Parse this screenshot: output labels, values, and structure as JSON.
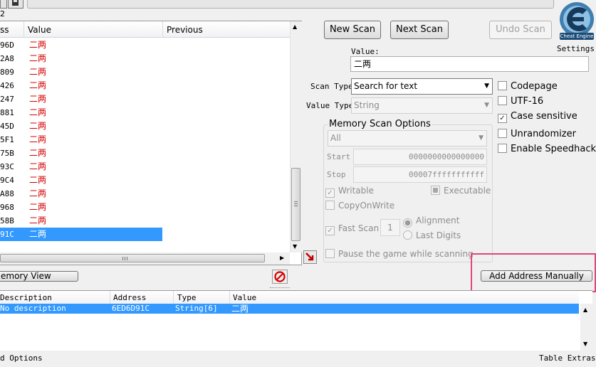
{
  "window": {
    "settings_label": "Settings",
    "logo_text": "Cheat Engine"
  },
  "found_list": {
    "left_cut_label": "2",
    "headers": {
      "address": "ss",
      "value": "Value",
      "previous": "Previous"
    },
    "rows": [
      {
        "addr": "96D",
        "value": "二两"
      },
      {
        "addr": "2A8",
        "value": "二两"
      },
      {
        "addr": "809",
        "value": "二两"
      },
      {
        "addr": "426",
        "value": "二两"
      },
      {
        "addr": "247",
        "value": "二两"
      },
      {
        "addr": "881",
        "value": "二两"
      },
      {
        "addr": "45D",
        "value": "二两"
      },
      {
        "addr": "5F1",
        "value": "二两"
      },
      {
        "addr": "75B",
        "value": "二两"
      },
      {
        "addr": "93C",
        "value": "二两"
      },
      {
        "addr": "9C4",
        "value": "二两"
      },
      {
        "addr": "A88",
        "value": "二两"
      },
      {
        "addr": "968",
        "value": "二两"
      },
      {
        "addr": "58B",
        "value": "二两"
      },
      {
        "addr": "91C",
        "value": "二两",
        "selected": true
      }
    ]
  },
  "scan": {
    "new_scan": "New Scan",
    "next_scan": "Next Scan",
    "undo_scan": "Undo Scan",
    "value_label": "Value:",
    "value": "二两",
    "scan_type_label": "Scan Type",
    "scan_type": "Search for text",
    "value_type_label": "Value Type",
    "value_type": "String"
  },
  "right_options": {
    "codepage": "Codepage",
    "utf16": "UTF-16",
    "case_sensitive": "Case sensitive",
    "unrandomizer": "Unrandomizer",
    "speedhack": "Enable Speedhack"
  },
  "memory_options": {
    "title": "Memory Scan Options",
    "region": "All",
    "start_label": "Start",
    "start": "0000000000000000",
    "stop_label": "Stop",
    "stop": "00007fffffffffff",
    "writable": "Writable",
    "executable": "Executable",
    "copy_on_write": "CopyOnWrite",
    "fast_scan": "Fast Scan",
    "fast_scan_value": "1",
    "alignment": "Alignment",
    "last_digits": "Last Digits",
    "pause_game": "Pause the game while scanning"
  },
  "middle_bar": {
    "memory_view": "emory View",
    "add_address_manually": "Add Address Manually"
  },
  "address_table": {
    "headers": {
      "description": "Description",
      "address": "Address",
      "type": "Type",
      "value": "Value"
    },
    "rows": [
      {
        "description": "No description",
        "address": "6ED6D91C",
        "type": "String[6]",
        "value": "二两"
      }
    ]
  },
  "footer": {
    "advanced_options": "d Options",
    "table_extras": "Table Extras"
  },
  "colors": {
    "selection": "#3399ff",
    "value_red": "#d40000",
    "highlight_box": "#e0457b"
  }
}
